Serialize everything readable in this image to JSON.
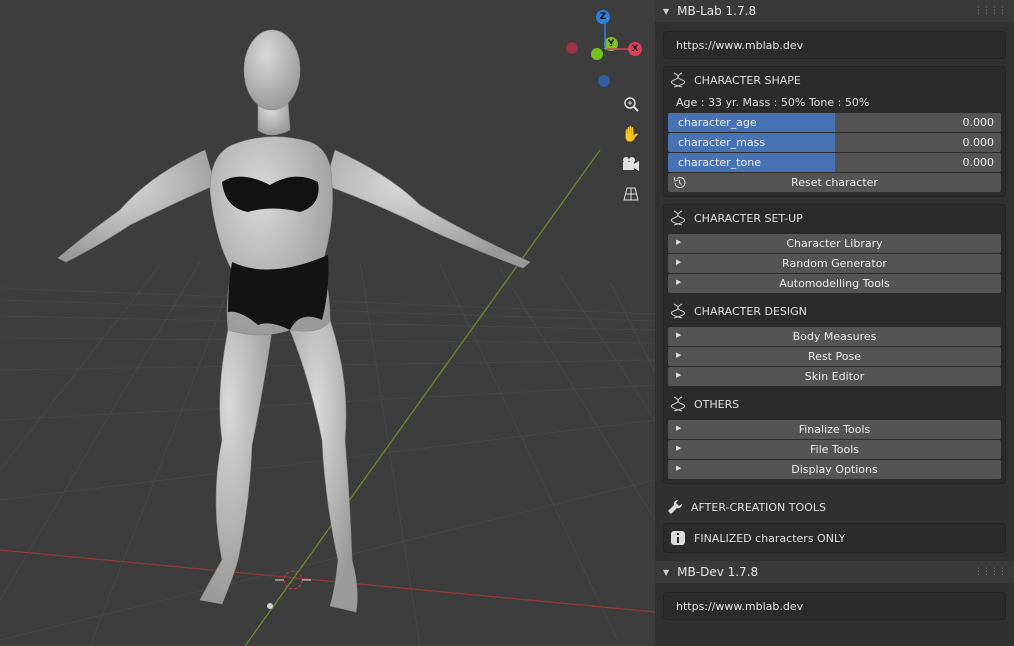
{
  "gizmo": {
    "z": "Z",
    "y": "Y",
    "x": "X"
  },
  "panel": {
    "title": "MB-Lab 1.7.8",
    "url": "https://www.mblab.dev",
    "shape": {
      "title": "CHARACTER SHAPE",
      "info": "Age : 33 yr.  Mass : 50%  Tone : 50%",
      "sliders": [
        {
          "label": "character_age",
          "value": "0.000",
          "fill": 0.5
        },
        {
          "label": "character_mass",
          "value": "0.000",
          "fill": 0.5
        },
        {
          "label": "character_tone",
          "value": "0.000",
          "fill": 0.5
        }
      ],
      "reset": "Reset character"
    },
    "setup": {
      "title": "CHARACTER SET-UP",
      "items": [
        "Character Library",
        "Random Generator",
        "Automodelling Tools"
      ]
    },
    "design": {
      "title": "CHARACTER DESIGN",
      "items": [
        "Body Measures",
        "Rest Pose",
        "Skin Editor"
      ]
    },
    "others": {
      "title": "OTHERS",
      "items": [
        "Finalize Tools",
        "File Tools",
        "Display Options"
      ]
    },
    "after": {
      "title": "AFTER-CREATION TOOLS",
      "note": "FINALIZED characters ONLY"
    }
  },
  "panel2": {
    "title": "MB-Dev 1.7.8",
    "url": "https://www.mblab.dev"
  }
}
